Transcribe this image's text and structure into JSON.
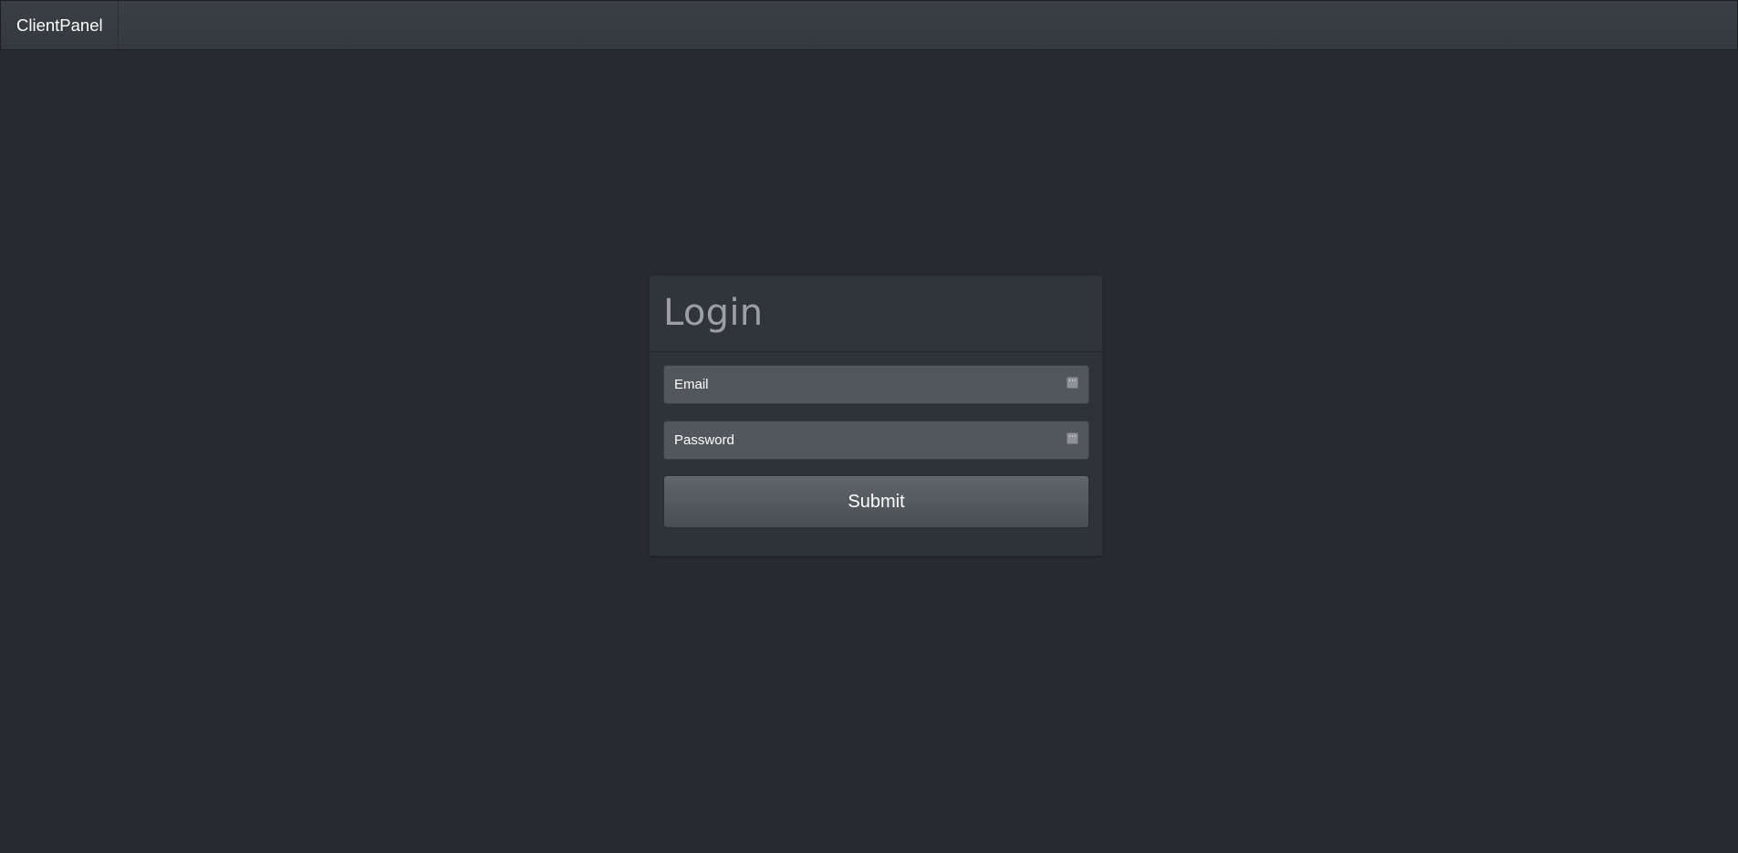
{
  "navbar": {
    "brand": "ClientPanel"
  },
  "login": {
    "title": "Login",
    "email": {
      "placeholder": "Email",
      "value": ""
    },
    "password": {
      "placeholder": "Password",
      "value": ""
    },
    "submit_label": "Submit",
    "field_icon": "ellipsis-icon"
  },
  "colors": {
    "background": "#272b30",
    "navbar": "#3a3f44",
    "panel": "#2e3338",
    "input": "#52575c",
    "button": "#5a5f64",
    "title_text": "#9ca0a4",
    "text": "#ffffff"
  }
}
